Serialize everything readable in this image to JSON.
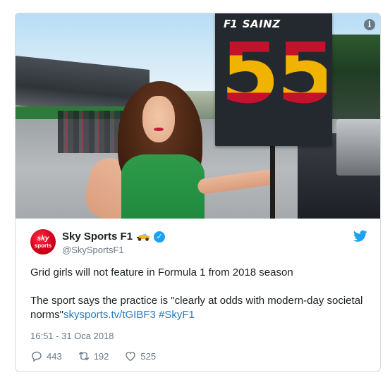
{
  "photo": {
    "sign": {
      "logo": "F1",
      "driver": "SAINZ",
      "number": "55"
    },
    "info_icon": "info-icon"
  },
  "tweet": {
    "avatar": {
      "line1": "sky",
      "line2": "sports"
    },
    "display_name": "Sky Sports F1",
    "handle": "@SkySportsF1",
    "text_line1": "Grid girls will not feature in Formula 1 from 2018 season",
    "text_line2a": "The sport says the practice is \"clearly at odds with modern-day societal norms\"",
    "link_url": "skysports.tv/tGIBF3",
    "hashtag": "#SkyF1",
    "timestamp": "16:51 - 31 Oca 2018",
    "replies": "443",
    "retweets": "192",
    "likes": "525"
  },
  "colors": {
    "twitter_blue": "#1da1f2",
    "link": "#2b7bb9",
    "muted": "#697882",
    "sky_red": "#d2001a",
    "spain_red": "#c4122d",
    "spain_yellow": "#f0b400"
  },
  "icons": [
    "info-icon",
    "car-emoji-icon",
    "verified-badge-icon",
    "twitter-bird-icon",
    "reply-icon",
    "retweet-icon",
    "like-icon"
  ]
}
